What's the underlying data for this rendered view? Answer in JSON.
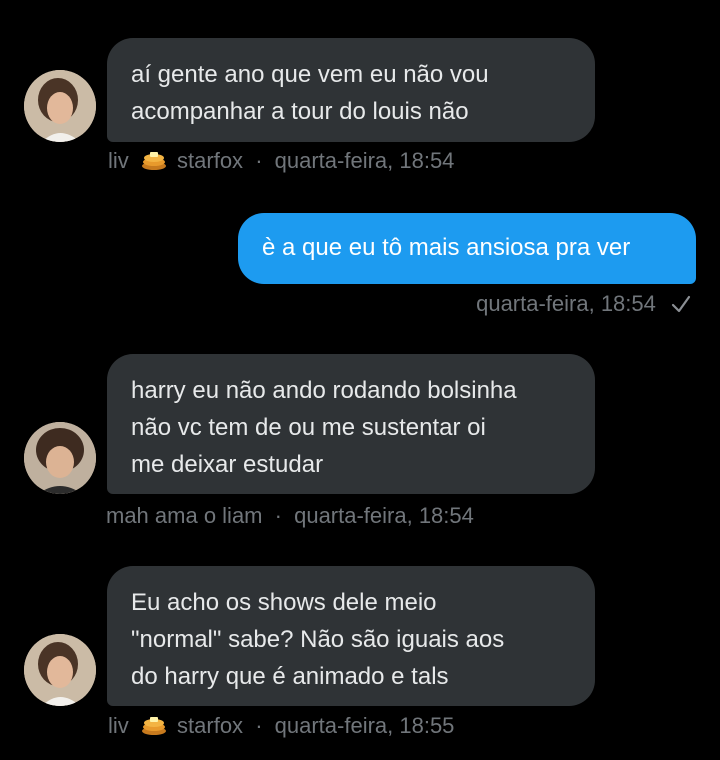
{
  "colors": {
    "background": "#000000",
    "incoming_bubble": "#2f3336",
    "outgoing_bubble": "#1d9bf0",
    "meta_text": "#71767b"
  },
  "messages": [
    {
      "lines": [
        "aí gente ano que vem eu não vou",
        "acompanhar a tour do louis não"
      ],
      "sender": "liv",
      "sender_icon": "pancake-emoji",
      "sender_rest": "starfox",
      "timestamp": "quarta-feira, 18:54"
    },
    {
      "lines": [
        "è a que eu tô mais ansiosa pra ver"
      ],
      "timestamp": "quarta-feira, 18:54",
      "status_icon": "checkmark-icon"
    },
    {
      "lines": [
        "harry eu não ando rodando bolsinha",
        "não vc tem de ou me sustentar oi",
        "me deixar estudar"
      ],
      "sender": "mah ama o liam",
      "timestamp": "quarta-feira, 18:54"
    },
    {
      "lines": [
        "Eu acho os shows dele meio",
        "\"normal\" sabe? Não são iguais aos",
        "do harry que é animado e tals"
      ],
      "sender": "liv",
      "sender_icon": "pancake-emoji",
      "sender_rest": "starfox",
      "timestamp": "quarta-feira, 18:55"
    }
  ],
  "separator": "·"
}
